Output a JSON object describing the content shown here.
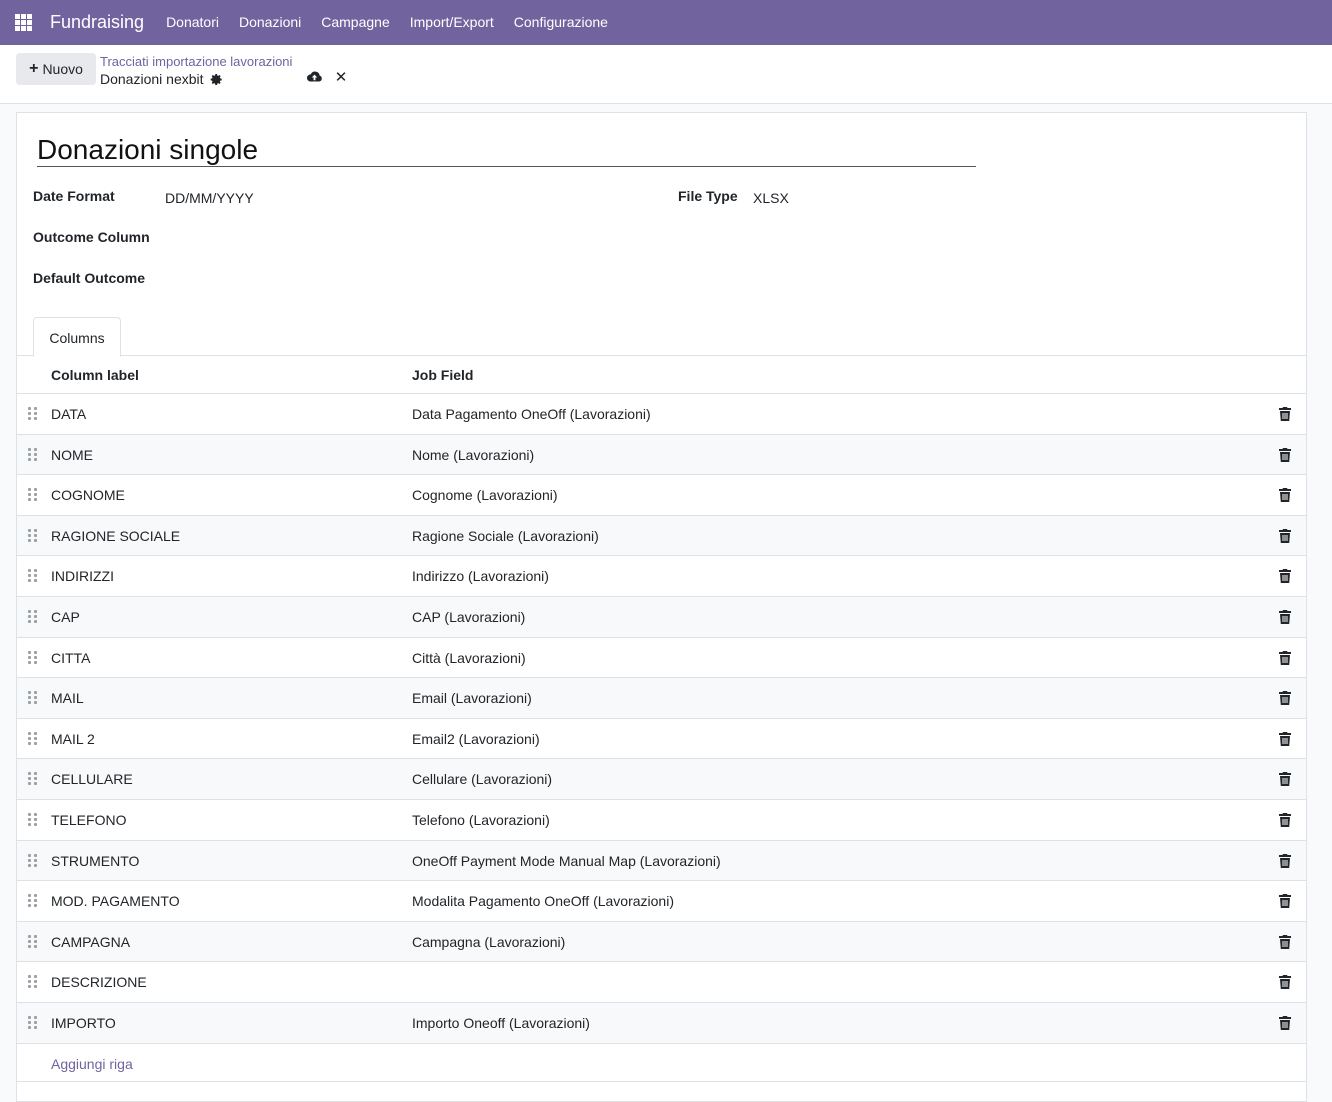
{
  "navbar": {
    "app_name": "Fundraising",
    "menu": [
      "Donatori",
      "Donazioni",
      "Campagne",
      "Import/Export",
      "Configurazione"
    ]
  },
  "control_panel": {
    "new_button": "Nuovo",
    "breadcrumb_parent": "Tracciati importazione lavorazioni",
    "breadcrumb_current": "Donazioni nexbit"
  },
  "form": {
    "title": "Donazioni singole",
    "fields": {
      "date_format_label": "Date Format",
      "date_format_value": "DD/MM/YYYY",
      "file_type_label": "File Type",
      "file_type_value": "XLSX",
      "outcome_column_label": "Outcome Column",
      "default_outcome_label": "Default Outcome"
    },
    "tab": "Columns",
    "table": {
      "headers": [
        "Column label",
        "Job Field"
      ],
      "rows": [
        {
          "label": "DATA",
          "field": "Data Pagamento OneOff (Lavorazioni)"
        },
        {
          "label": "NOME",
          "field": "Nome (Lavorazioni)"
        },
        {
          "label": "COGNOME",
          "field": "Cognome (Lavorazioni)"
        },
        {
          "label": "RAGIONE SOCIALE",
          "field": "Ragione Sociale (Lavorazioni)"
        },
        {
          "label": "INDIRIZZI",
          "field": "Indirizzo (Lavorazioni)"
        },
        {
          "label": "CAP",
          "field": "CAP (Lavorazioni)"
        },
        {
          "label": "CITTA",
          "field": "Città (Lavorazioni)"
        },
        {
          "label": "MAIL",
          "field": "Email (Lavorazioni)"
        },
        {
          "label": "MAIL 2",
          "field": "Email2 (Lavorazioni)"
        },
        {
          "label": "CELLULARE",
          "field": "Cellulare (Lavorazioni)"
        },
        {
          "label": "TELEFONO",
          "field": "Telefono (Lavorazioni)"
        },
        {
          "label": "STRUMENTO",
          "field": "OneOff Payment Mode Manual Map (Lavorazioni)"
        },
        {
          "label": "MOD. PAGAMENTO",
          "field": "Modalita Pagamento OneOff (Lavorazioni)"
        },
        {
          "label": "CAMPAGNA",
          "field": "Campagna (Lavorazioni)"
        },
        {
          "label": "DESCRIZIONE",
          "field": ""
        },
        {
          "label": "IMPORTO",
          "field": "Importo Oneoff (Lavorazioni)"
        }
      ],
      "add_line": "Aggiungi riga"
    }
  },
  "colors": {
    "brand": "#71639e",
    "border": "#dee2e6",
    "stripe": "#f8f9fa"
  },
  "icons": [
    "apps-grid-icon",
    "plus-icon",
    "gear-icon",
    "cloud-upload-icon",
    "close-icon",
    "drag-handle-icon",
    "trash-icon"
  ]
}
